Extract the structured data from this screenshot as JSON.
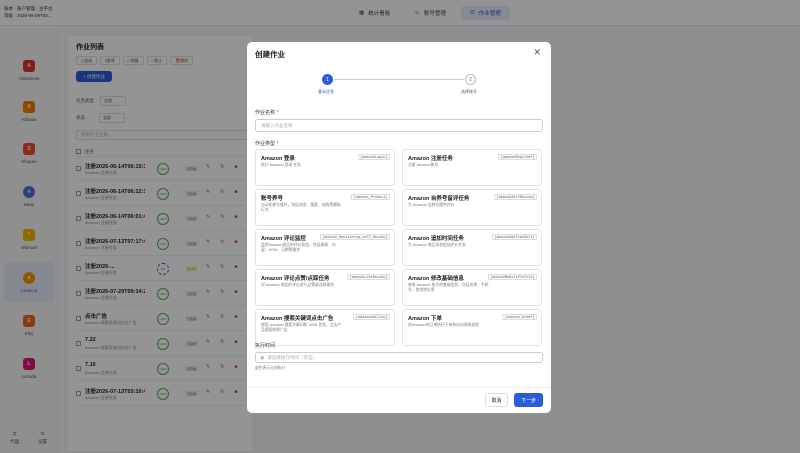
{
  "brand": {
    "line1": "账本 · 账户管理 · 主平台",
    "line2": "等级 · 2026-06-09T02..."
  },
  "nav": {
    "tabs": [
      {
        "label": "统计看板"
      },
      {
        "label": "账号管理"
      },
      {
        "label": "作业管理"
      }
    ],
    "active": 2
  },
  "sidebar": {
    "items": [
      {
        "label": "Aliexpress",
        "logo": "A",
        "color": "#e0312d"
      },
      {
        "label": "Alibaba",
        "logo": "A",
        "color": "#f57c00"
      },
      {
        "label": "Shopee",
        "logo": "S",
        "color": "#ee4d2d"
      },
      {
        "label": "eBay",
        "logo": "e",
        "color": "#5b6fd6"
      },
      {
        "label": "Walmart",
        "logo": "*",
        "color": "#f5b400"
      },
      {
        "label": "Amazon",
        "logo": "a",
        "color": "#f59a00"
      },
      {
        "label": "Etsy",
        "logo": "E",
        "color": "#f1641e"
      },
      {
        "label": "Lazada",
        "logo": "L",
        "color": "#e6137d"
      }
    ],
    "active": 5,
    "bottom": [
      {
        "label": "代理"
      },
      {
        "label": "设置"
      }
    ]
  },
  "panel": {
    "title": "作业列表",
    "toolbar": [
      {
        "label": "启动"
      },
      {
        "label": "暂停"
      },
      {
        "label": "恢复"
      },
      {
        "label": "停止"
      },
      {
        "label": "删除"
      }
    ],
    "create_label": "+ 创建作业",
    "filter1_label": "任务类型",
    "filter1_value": "全部",
    "filter2_label": "状态",
    "filter2_value": "全部",
    "search_placeholder": "搜索作业名称...",
    "table_head": "任务",
    "rows": [
      {
        "title": "注册2026-06-14T06:15:37....",
        "sub": "Amazon 注册任务",
        "circle": "100%",
        "badge": "已完成"
      },
      {
        "title": "注册2026-06-14T06:12:15....",
        "sub": "Amazon 注册任务",
        "circle": "100%",
        "badge": "已完成"
      },
      {
        "title": "注册2026-06-14T06:01:48....",
        "sub": "Amazon 注册任务",
        "circle": "100%",
        "badge": "已完成"
      },
      {
        "title": "注册2026-07-13T07:17:45....",
        "sub": "Amazon 注册任务",
        "circle": "100%",
        "badge": "已完成"
      },
      {
        "title": "注册2026-...",
        "sub": "Amazon 注册任务",
        "circle": "0%",
        "badge": "运行中"
      },
      {
        "title": "注册2026-07-29T09:14:25....",
        "sub": "Amazon 注册任务",
        "circle": "100%",
        "badge": "已完成"
      },
      {
        "title": "点击广告",
        "sub": "Amazon 搜索关键词点击广告",
        "circle": "100%",
        "badge": "已完成"
      },
      {
        "title": "7.22",
        "sub": "Amazon 搜索关键词点击广告",
        "circle": "100%",
        "badge": "已完成"
      },
      {
        "title": "7.16",
        "sub": "Amazon 注册任务",
        "circle": "100%",
        "badge": "已完成"
      },
      {
        "title": "注册2026-07-13T03:10:45....",
        "sub": "Amazon 注册任务",
        "circle": "100%",
        "badge": "已完成"
      }
    ]
  },
  "modal": {
    "title": "创建作业",
    "steps": [
      {
        "num": "1",
        "label": "基本信息"
      },
      {
        "num": "2",
        "label": "选择账号"
      }
    ],
    "name_label": "作业名称",
    "name_placeholder": "请输入作业名称",
    "type_label": "作业类型",
    "types": [
      {
        "title": "Amazon 登录",
        "key": "[amazonLogin]",
        "desc": "执行 Amazon 登录 任务"
      },
      {
        "title": "Amazon 注册任务",
        "key": "[amazonRegister]",
        "desc": "注册 Amazon账号"
      },
      {
        "title": "账号养号",
        "key": "[amazon_Product]",
        "desc": "自动化养号操作，包括浏览、搜索、加购等模拟行为"
      },
      {
        "title": "Amazon 自养号留评任务",
        "key": "[amazonSelfReview]",
        "desc": "为 Amazon 自养号提供评价"
      },
      {
        "title": "Amazon 评论监控",
        "key": "[amazon_monitoring_self_Review]",
        "desc": "监控Amazon商品的评价状态，包括星级、内容、ASIN、日期等操作"
      },
      {
        "title": "Amazon 追加时间任务",
        "key": "[amazonAddTimeSelf]",
        "desc": "为 Amazon 商品添加追加评价任务"
      },
      {
        "title": "Amazon 评论点赞/点踩任务",
        "key": "[amazonLikeReview]",
        "desc": "对 Amazon 商品的评论进行点赞或点踩操作"
      },
      {
        "title": "Amazon 修改基础信息",
        "key": "[amazonModifyProfile]",
        "desc": "修改 Amazon 账号的基础信息，包括名称、手机号、收货地址等"
      },
      {
        "title": "Amazon 搜索关键词点击广告",
        "key": "[amazonAdClick]",
        "desc": "使用 Amazon 搜索关键词和 ASIN 信息，点击产品搜索结果广告"
      },
      {
        "title": "Amazon 下单",
        "key": "[amazon_Order]",
        "desc": "在Amazon的订单执行下单和自动采购流程"
      }
    ],
    "time_label": "执行时间",
    "time_placeholder": "请选择执行时间（可选）",
    "time_hint": "留空表示立即执行",
    "cancel_label": "取消",
    "next_label": "下一步"
  },
  "colors": {
    "primary": "#2b5cd8",
    "success": "#4caf50",
    "danger": "#dd3333"
  }
}
